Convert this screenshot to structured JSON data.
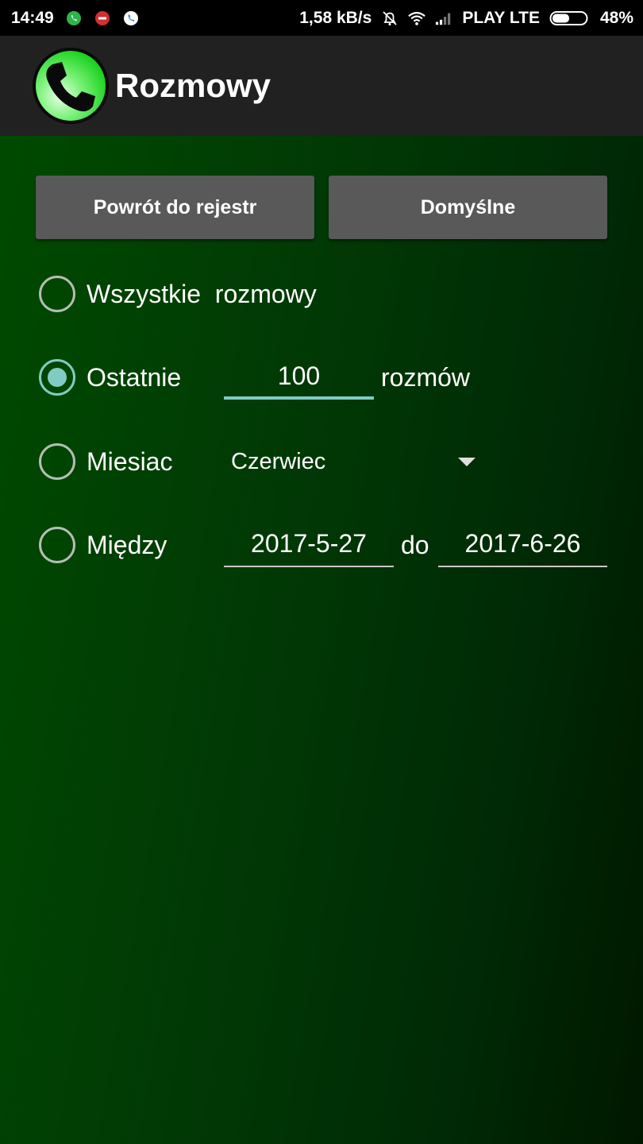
{
  "status_bar": {
    "time": "14:49",
    "speed": "1,58 kB/s",
    "carrier": "PLAY LTE",
    "battery": "48%"
  },
  "app_bar": {
    "title": "Rozmowy"
  },
  "buttons": {
    "back_label": "Powrót do rejestr",
    "default_label": "Domyślne"
  },
  "options": {
    "all": {
      "label": "Wszystkie  rozmowy",
      "checked": false
    },
    "last": {
      "label": "Ostatnie",
      "count": "100",
      "suffix": "rozmów",
      "checked": true
    },
    "month": {
      "label": "Miesiac",
      "selected": "Czerwiec",
      "checked": false
    },
    "between": {
      "label": "Między",
      "from": "2017-5-27",
      "separator": "do",
      "to": "2017-6-26",
      "checked": false
    }
  },
  "colors": {
    "accent": "#80cbc4",
    "app_bar": "#212121",
    "button": "#595959",
    "background_start": "#004a00",
    "background_end": "#001800"
  }
}
